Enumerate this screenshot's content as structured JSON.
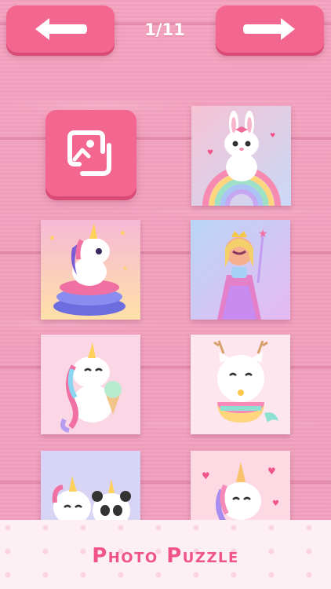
{
  "header": {
    "prev_icon": "arrow-left-icon",
    "next_icon": "arrow-right-icon",
    "counter": "1/11"
  },
  "gallery_button": {
    "icon": "photo-gallery-icon"
  },
  "puzzles": [
    {
      "name": "bunny-on-rainbow"
    },
    {
      "name": "unicorn-on-pillows"
    },
    {
      "name": "unicorn-princess"
    },
    {
      "name": "unicorn-with-ice-cream"
    },
    {
      "name": "cat-mermaid"
    },
    {
      "name": "unicorn-and-panda"
    },
    {
      "name": "unicorn-with-hearts"
    }
  ],
  "footer": {
    "title": "Photo Puzzle"
  },
  "colors": {
    "button": "#f3668f",
    "button_shadow": "#d94a74",
    "background": "#f2a0bd",
    "footer_bg": "#fdf0f4",
    "footer_text": "#f0548a"
  }
}
